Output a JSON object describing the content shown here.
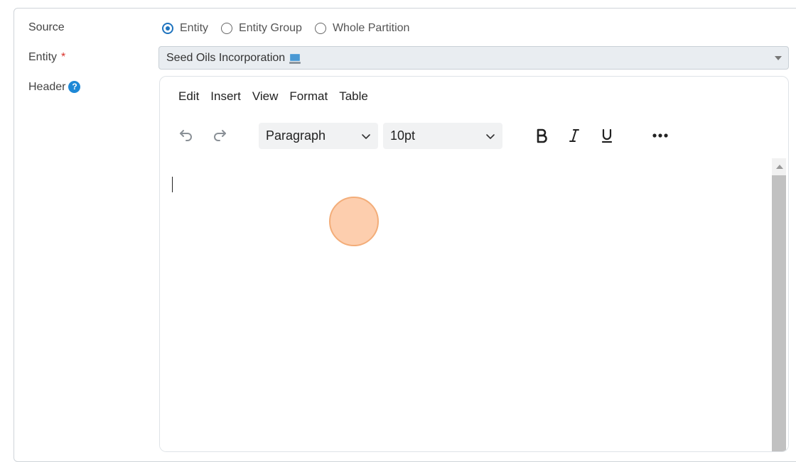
{
  "form": {
    "source_label": "Source",
    "entity_label": "Entity",
    "entity_required_mark": "*",
    "header_label": "Header",
    "header_help_glyph": "?",
    "source_options": [
      {
        "label": "Entity",
        "selected": true
      },
      {
        "label": "Entity Group",
        "selected": false
      },
      {
        "label": "Whole Partition",
        "selected": false
      }
    ],
    "entity_value": "Seed Oils Incorporation",
    "entity_value_icon": "monitor-icon"
  },
  "editor": {
    "menu": [
      "Edit",
      "Insert",
      "View",
      "Format",
      "Table"
    ],
    "block_format": "Paragraph",
    "font_size": "10pt",
    "toolbar_icons": [
      "undo-icon",
      "redo-icon",
      "bold-icon",
      "italic-icon",
      "underline-icon",
      "more-icon"
    ],
    "content": ""
  },
  "colors": {
    "accent": "#1e73be",
    "help_badge": "#1e88d6",
    "required": "#d9312b",
    "select_bg": "#e9edf1",
    "cursor_highlight": "#fdc6a0"
  }
}
